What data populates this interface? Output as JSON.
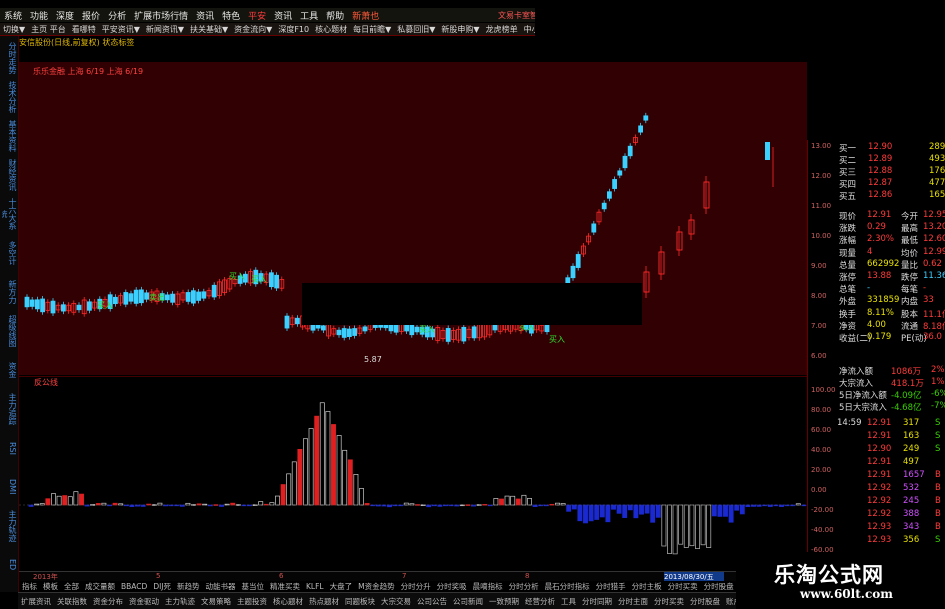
{
  "menu": {
    "items": [
      "系统",
      "功能",
      "深度",
      "报价",
      "分析",
      "扩展市场行情",
      "资讯",
      "特色",
      "平安",
      "资讯",
      "工具",
      "帮助",
      "新萧也"
    ],
    "right_text": "文易卡室智"
  },
  "funcbar": {
    "items": [
      "切换▼",
      "主页 平台",
      "看哪特",
      "平安资讯▼",
      "新闻资讯▼",
      "扶关基础▼",
      "资金流向▼",
      "深度F10",
      "核心题材",
      "每日前瞻▼",
      "私募回旧▼",
      "新股申购▼",
      "龙虎榜单",
      "中小板▼",
      "创业"
    ]
  },
  "title": "安信股份(日线,前复权)  状态标签",
  "main_header": "乐乐金融 上海 6/19  上海 6/19",
  "left_tabs": [
    "分时走势",
    "技术分析",
    "基本资料",
    "财经资讯",
    "十六大系统",
    "多空计",
    "新方力",
    "超级线图",
    "资金",
    "主力追踪",
    "RSI",
    "DMI",
    "主力轨迹",
    "ED"
  ],
  "sub_title": "反公线",
  "price_axis": [
    "13.00",
    "12.00",
    "11.00",
    "10.00",
    "9.00",
    "8.00",
    "7.00",
    "6.00"
  ],
  "sub_axis": [
    "100.00",
    "80.00",
    "60.00",
    "40.00",
    "20.00",
    "0.00",
    "-20.00",
    "-40.00",
    "-60.00"
  ],
  "annotations": {
    "low_price": "5.87",
    "buy_labels": [
      "买入",
      "买入",
      "卖出",
      "买入",
      "买入",
      "买入",
      "买入"
    ]
  },
  "quote": {
    "bid_rows": [
      {
        "label": "买一",
        "price": "12.90",
        "vol": "289"
      },
      {
        "label": "买二",
        "price": "12.89",
        "vol": "493"
      },
      {
        "label": "买三",
        "price": "12.88",
        "vol": "176"
      },
      {
        "label": "买四",
        "price": "12.87",
        "vol": "477"
      },
      {
        "label": "买五",
        "price": "12.86",
        "vol": "165"
      }
    ],
    "stats": [
      {
        "l1": "现价",
        "v1": "12.91",
        "l2": "今开",
        "v2": "12.95"
      },
      {
        "l1": "涨跌",
        "v1": "0.29",
        "l2": "最高",
        "v2": "13.20"
      },
      {
        "l1": "涨幅",
        "v1": "2.30%",
        "l2": "最低",
        "v2": "12.60"
      },
      {
        "l1": "现量",
        "v1": "4",
        "l2": "均价",
        "v2": "12.99"
      },
      {
        "l1": "总量",
        "v1": "662992",
        "l2": "量比",
        "v2": "0.62"
      },
      {
        "l1": "涨停",
        "v1": "13.88",
        "l2": "跌停",
        "v2": "11.36"
      },
      {
        "l1": "总笔",
        "v1": "-",
        "l2": "每笔",
        "v2": "-"
      },
      {
        "l1": "外盘",
        "v1": "331859",
        "l2": "内盘",
        "v2": "33"
      },
      {
        "l1": "换手",
        "v1": "8.11%",
        "l2": "股本",
        "v2": "11.1亿"
      },
      {
        "l1": "净资",
        "v1": "4.00",
        "l2": "流通",
        "v2": "8.18亿"
      },
      {
        "l1": "收益(二)",
        "v1": "0.179",
        "l2": "PE(动)",
        "v2": "36.0"
      }
    ],
    "flows": [
      {
        "label": "净流入额",
        "value": "1086万",
        "pct": "2%"
      },
      {
        "label": "大宗流入",
        "value": "418.1万",
        "pct": "1%"
      },
      {
        "label": "5日净流入额",
        "value": "-4.09亿",
        "pct": "-6%"
      },
      {
        "label": "5日大宗流入",
        "value": "-4.68亿",
        "pct": "-7%"
      }
    ],
    "ticks": [
      {
        "time": "14:59",
        "price": "12.91",
        "vol": "317",
        "bs": "S"
      },
      {
        "time": "",
        "price": "12.91",
        "vol": "163",
        "bs": "S"
      },
      {
        "time": "",
        "price": "12.90",
        "vol": "249",
        "bs": "S"
      },
      {
        "time": "",
        "price": "12.91",
        "vol": "497",
        "bs": ""
      },
      {
        "time": "",
        "price": "12.91",
        "vol": "1657",
        "bs": "B"
      },
      {
        "time": "",
        "price": "12.92",
        "vol": "532",
        "bs": "B"
      },
      {
        "time": "",
        "price": "12.92",
        "vol": "245",
        "bs": "B"
      },
      {
        "time": "",
        "price": "12.92",
        "vol": "388",
        "bs": "B"
      },
      {
        "time": "",
        "price": "12.93",
        "vol": "343",
        "bs": "B"
      },
      {
        "time": "",
        "price": "12.93",
        "vol": "356",
        "bs": "S"
      }
    ]
  },
  "timeline": {
    "labels": [
      "2013年",
      "5",
      "6",
      "7",
      "8"
    ],
    "highlight": "2013/08/30/五"
  },
  "tabs": [
    "指标",
    "模板",
    "全部",
    "成交量额",
    "BBACD",
    "DIJ死",
    "新趋势",
    "动能书器",
    "基当位",
    "精准买卖",
    "KLFL",
    "大盘了",
    "M资金趋势",
    "分时分升",
    "分时奖吸",
    "晨嘀指标",
    "分时分析",
    "晨石分时指标",
    "分时猎手",
    "分时主板",
    "分时买卖",
    "分时股盘"
  ],
  "status": [
    "扩展资讯",
    "关联指数",
    "资金分布",
    "资金驱动",
    "主力轨迹",
    "文易策略",
    "主题投资",
    "核心题材",
    "热点题材",
    "同题板块",
    "大宗交易",
    "公司公告",
    "公司新闻",
    "一致预期",
    "经营分析",
    "工具",
    "分时同期",
    "分时主面",
    "分时买卖",
    "分时股盘",
    "账户",
    "持仓",
    "委托"
  ],
  "watermark": {
    "name": "乐淘公式网",
    "url": "www.60lt.com"
  },
  "colors": {
    "up": "#ff2a2a",
    "down": "#3ad0ff",
    "bg_main": "#300002",
    "axis": "#d06060",
    "vol_down": "#1a2ad0"
  }
}
